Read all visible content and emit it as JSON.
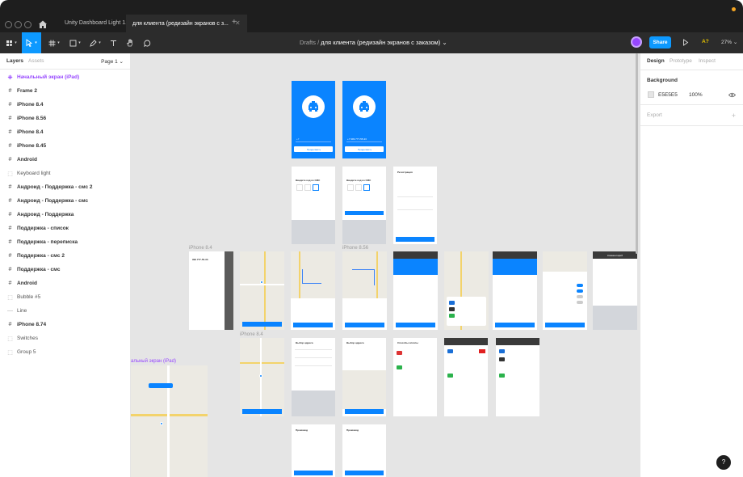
{
  "window": {
    "tabs": [
      {
        "label": "Unity Dashboard Light 1.0"
      },
      {
        "label": "для клиента (редизайн экранов с з..."
      }
    ]
  },
  "toolbar": {
    "breadcrumb_parent": "Drafts",
    "breadcrumb_separator": "/",
    "document_title": "для клиента (редизайн экранов с заказом)",
    "share_label": "Share",
    "ai_label": "A?",
    "zoom": "27%"
  },
  "layers_panel": {
    "tab_layers": "Layers",
    "tab_assets": "Assets",
    "page_selector": "Page 1",
    "items": [
      {
        "label": "Начальный экран (iPad)",
        "kind": "component"
      },
      {
        "label": "Frame 2",
        "kind": "frame"
      },
      {
        "label": "iPhone 8.4",
        "kind": "frame"
      },
      {
        "label": "iPhone 8.56",
        "kind": "frame"
      },
      {
        "label": "iPhone 8.4",
        "kind": "frame"
      },
      {
        "label": "iPhone 8.45",
        "kind": "frame"
      },
      {
        "label": "Android",
        "kind": "frame"
      },
      {
        "label": "Keyboard light",
        "kind": "group"
      },
      {
        "label": "Андроид - Поддержка - смс 2",
        "kind": "frame"
      },
      {
        "label": "Андроид - Поддержка - смс",
        "kind": "frame"
      },
      {
        "label": "Андроид - Поддержка",
        "kind": "frame"
      },
      {
        "label": "Поддержка - список",
        "kind": "frame"
      },
      {
        "label": "Поддержка - переписка",
        "kind": "frame"
      },
      {
        "label": "Поддержка - смс 2",
        "kind": "frame"
      },
      {
        "label": "Поддержка - смс",
        "kind": "frame"
      },
      {
        "label": "Android",
        "kind": "frame"
      },
      {
        "label": "Bubble #5",
        "kind": "group"
      },
      {
        "label": "Line",
        "kind": "line"
      },
      {
        "label": "iPhone 8.74",
        "kind": "frame"
      },
      {
        "label": "Switches",
        "kind": "group"
      },
      {
        "label": "Group 5",
        "kind": "group"
      }
    ]
  },
  "canvas": {
    "frame_labels": {
      "iphone84_a": "iPhone 8.4",
      "iphone856": "iPhone 8.56",
      "iphone84_b": "iPhone 8.4",
      "ipad": "альный экран (iPad)"
    },
    "screens": {
      "enter_code": "Введите код из СМС",
      "registration": "Регистрация",
      "choose_address": "Выбор адреса",
      "payment_methods": "Способы оплаты",
      "comment": "Комментарий",
      "phone_placeholder": "+7",
      "phone_number": "999 777-55-33",
      "continue": "Продолжить",
      "ready": "Готово",
      "promo": "Промокод"
    }
  },
  "design_panel": {
    "tab_design": "Design",
    "tab_prototype": "Prototype",
    "tab_inspect": "Inspect",
    "background_label": "Background",
    "background_hex": "E5E5E5",
    "background_opacity": "100%",
    "export_label": "Export"
  },
  "colors": {
    "accent": "#0D99FF",
    "app_blue": "#0A84FF",
    "canvas_bg": "#E5E5E5",
    "component": "#9747FF"
  }
}
